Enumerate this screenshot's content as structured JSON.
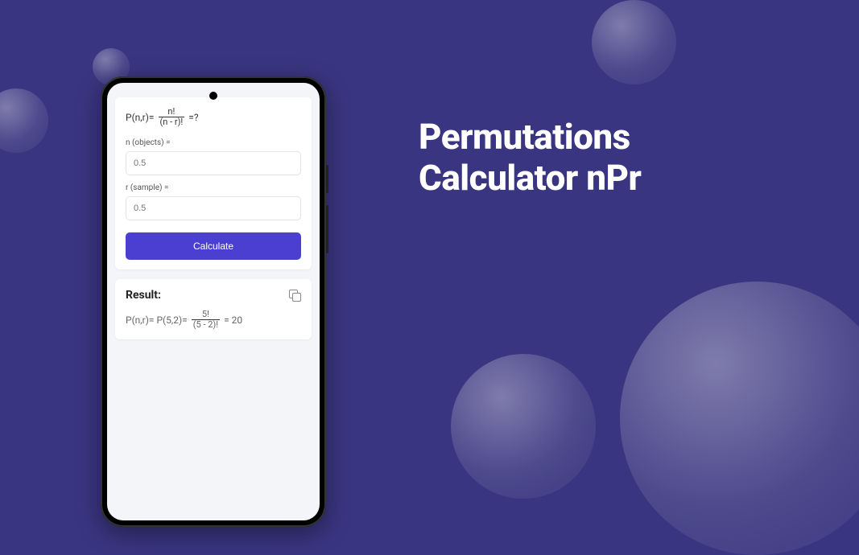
{
  "hero": {
    "title_line1": "Permutations",
    "title_line2": "Calculator nPr"
  },
  "calculator": {
    "formula": {
      "lhs": "P(n,r)=",
      "numerator": "n!",
      "denominator": "(n - r)!",
      "suffix": "=?"
    },
    "fields": {
      "n_label": "n (objects) =",
      "n_placeholder": "0.5",
      "r_label": "r (sample) =",
      "r_placeholder": "0.5"
    },
    "calculate_label": "Calculate"
  },
  "result": {
    "title": "Result:",
    "prefix": "P(n,r)= P(5,2)=",
    "numerator": "5!",
    "denominator": "(5 - 2)!",
    "equals_value": "= 20"
  },
  "colors": {
    "background": "#3a3580",
    "accent": "#4b3fd1"
  }
}
